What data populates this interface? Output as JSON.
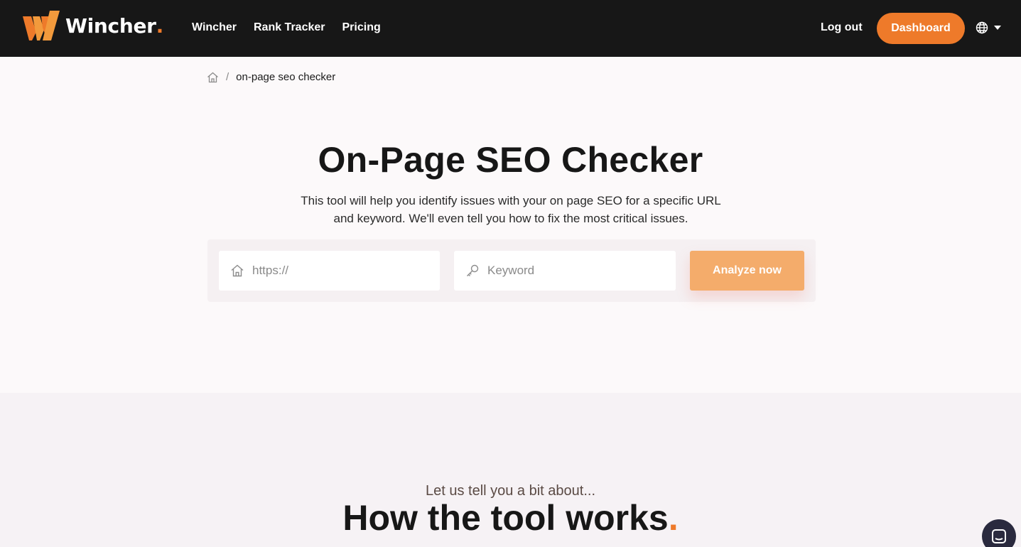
{
  "header": {
    "brand": "Wincher",
    "brand_dot": ".",
    "nav": [
      "Wincher",
      "Rank Tracker",
      "Pricing"
    ],
    "logout": "Log out",
    "dashboard": "Dashboard",
    "language_icon": "globe-icon"
  },
  "breadcrumb": {
    "home_icon": "home-icon",
    "separator": "/",
    "current": "on-page seo checker"
  },
  "hero": {
    "title": "On-Page SEO Checker",
    "description": "This tool will help you identify issues with your on page SEO for a specific URL and keyword. We'll even tell you how to fix the most critical issues."
  },
  "form": {
    "url_placeholder": "https://",
    "url_value": "",
    "keyword_placeholder": "Keyword",
    "keyword_value": "",
    "submit": "Analyze now"
  },
  "section": {
    "kicker": "Let us tell you a bit about...",
    "title": "How the tool works",
    "title_dot": "."
  },
  "colors": {
    "accent": "#ee7a2a",
    "header_bg": "#171717",
    "button_light": "#f4ac6b"
  }
}
